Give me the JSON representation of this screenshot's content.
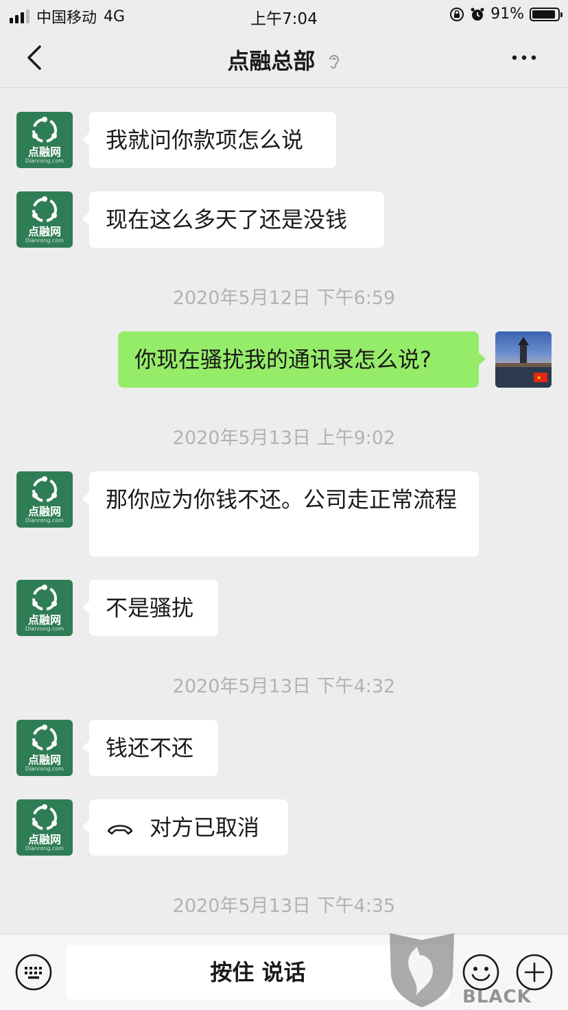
{
  "status_bar": {
    "carrier": "中国移动",
    "network": "4G",
    "time": "上午7:04",
    "battery": "91%"
  },
  "nav": {
    "title": "点融总部"
  },
  "avatar": {
    "brand_text": "点融网",
    "brand_sub": "Dianrong.com"
  },
  "messages": [
    {
      "side": "left",
      "text": "我就问你款项怎么说"
    },
    {
      "side": "left",
      "text": "现在这么多天了还是没钱"
    },
    {
      "type": "time",
      "text": "2020年5月12日 下午6:59"
    },
    {
      "side": "right",
      "text": "你现在骚扰我的通讯录怎么说?"
    },
    {
      "type": "time",
      "text": "2020年5月13日 上午9:02"
    },
    {
      "side": "left",
      "text": "那你应为你钱不还。公司走正常流程"
    },
    {
      "side": "left",
      "text": "不是骚扰"
    },
    {
      "type": "time",
      "text": "2020年5月13日 下午4:32"
    },
    {
      "side": "left",
      "text": "钱还不还"
    },
    {
      "side": "left",
      "call": true,
      "text": "对方已取消"
    },
    {
      "type": "time",
      "text": "2020年5月13日 下午4:35"
    }
  ],
  "bottom_bar": {
    "talk_label": "按住 说话"
  },
  "watermark": {
    "text": "BLACK CAT"
  },
  "colors": {
    "background": "#ededed",
    "self_bubble": "#95ec69",
    "other_bubble": "#ffffff",
    "avatar_green": "#2f7d55",
    "timestamp": "#b2b2b2"
  }
}
